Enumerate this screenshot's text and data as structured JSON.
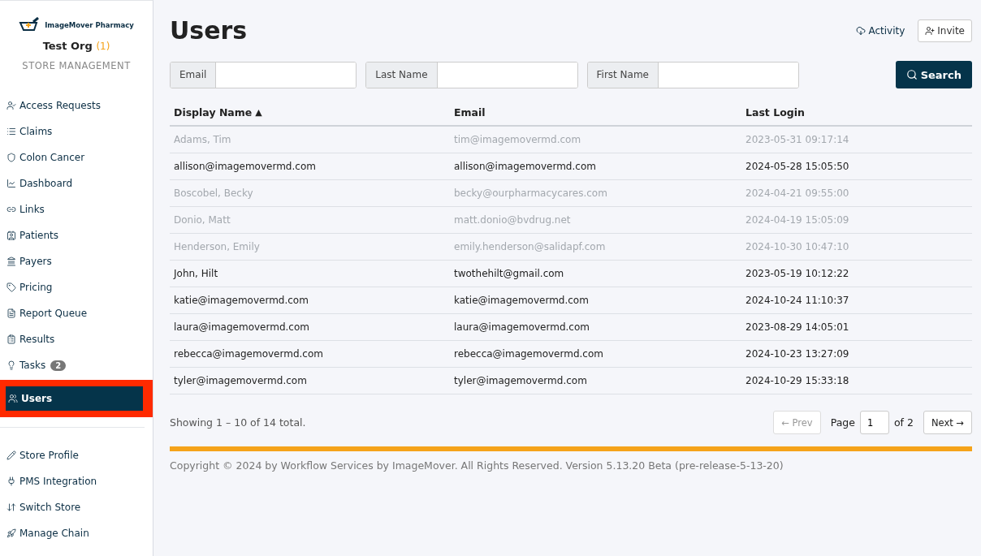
{
  "brand": {
    "name": "ImageMover Pharmacy",
    "org": "Test Org",
    "org_count": "(1)",
    "section": "STORE MANAGEMENT"
  },
  "nav": [
    {
      "label": "Access Requests",
      "selected": false
    },
    {
      "label": "Claims",
      "selected": false
    },
    {
      "label": "Colon Cancer",
      "selected": false
    },
    {
      "label": "Dashboard",
      "selected": false
    },
    {
      "label": "Links",
      "selected": false
    },
    {
      "label": "Patients",
      "selected": false
    },
    {
      "label": "Payers",
      "selected": false
    },
    {
      "label": "Pricing",
      "selected": false
    },
    {
      "label": "Report Queue",
      "selected": false
    },
    {
      "label": "Results",
      "selected": false
    },
    {
      "label": "Tasks",
      "selected": false,
      "badge": "2"
    },
    {
      "label": "Users",
      "selected": true
    }
  ],
  "nav_secondary": [
    {
      "label": "Store Profile"
    },
    {
      "label": "PMS Integration"
    },
    {
      "label": "Switch Store"
    },
    {
      "label": "Manage Chain"
    }
  ],
  "title": "Users",
  "actions": {
    "activity": "Activity",
    "invite": "Invite"
  },
  "filters": [
    {
      "label": "Email"
    },
    {
      "label": "Last Name"
    },
    {
      "label": "First Name"
    }
  ],
  "search_button": "Search",
  "table": {
    "columns": [
      {
        "label": "Display Name",
        "sort_mark": "▲"
      },
      {
        "label": "Email"
      },
      {
        "label": "Last Login"
      }
    ],
    "rows": [
      {
        "cells": [
          "Adams, Tim",
          "tim@imagemovermd.com",
          "2023-05-31 09:17:14"
        ],
        "disabled": true
      },
      {
        "cells": [
          "allison@imagemovermd.com",
          "allison@imagemovermd.com",
          "2024-05-28 15:05:50"
        ],
        "disabled": false
      },
      {
        "cells": [
          "Boscobel, Becky",
          "becky@ourpharmacycares.com",
          "2024-04-21 09:55:00"
        ],
        "disabled": true
      },
      {
        "cells": [
          "Donio, Matt",
          "matt.donio@bvdrug.net",
          "2024-04-19 15:05:09"
        ],
        "disabled": true
      },
      {
        "cells": [
          "Henderson, Emily",
          "emily.henderson@salidapf.com",
          "2024-10-30 10:47:10"
        ],
        "disabled": true
      },
      {
        "cells": [
          "John, Hilt",
          "twothehilt@gmail.com",
          "2023-05-19 10:12:22"
        ],
        "disabled": false
      },
      {
        "cells": [
          "katie@imagemovermd.com",
          "katie@imagemovermd.com",
          "2024-10-24 11:10:37"
        ],
        "disabled": false
      },
      {
        "cells": [
          "laura@imagemovermd.com",
          "laura@imagemovermd.com",
          "2023-08-29 14:05:01"
        ],
        "disabled": false
      },
      {
        "cells": [
          "rebecca@imagemovermd.com",
          "rebecca@imagemovermd.com",
          "2024-10-23 13:27:09"
        ],
        "disabled": false
      },
      {
        "cells": [
          "tyler@imagemovermd.com",
          "tyler@imagemovermd.com",
          "2024-10-29 15:33:18"
        ],
        "disabled": false
      }
    ]
  },
  "pagination": {
    "summary": "Showing 1 – 10 of 14 total.",
    "prev": "← Prev",
    "prev_disabled": true,
    "page_label": "Page",
    "page": "1",
    "of": "of 2",
    "next": "Next →"
  },
  "footer": "Copyright © 2024 by Workflow Services by ImageMover. All Rights Reserved. Version 5.13.20 Beta (pre-release-5-13-20)"
}
